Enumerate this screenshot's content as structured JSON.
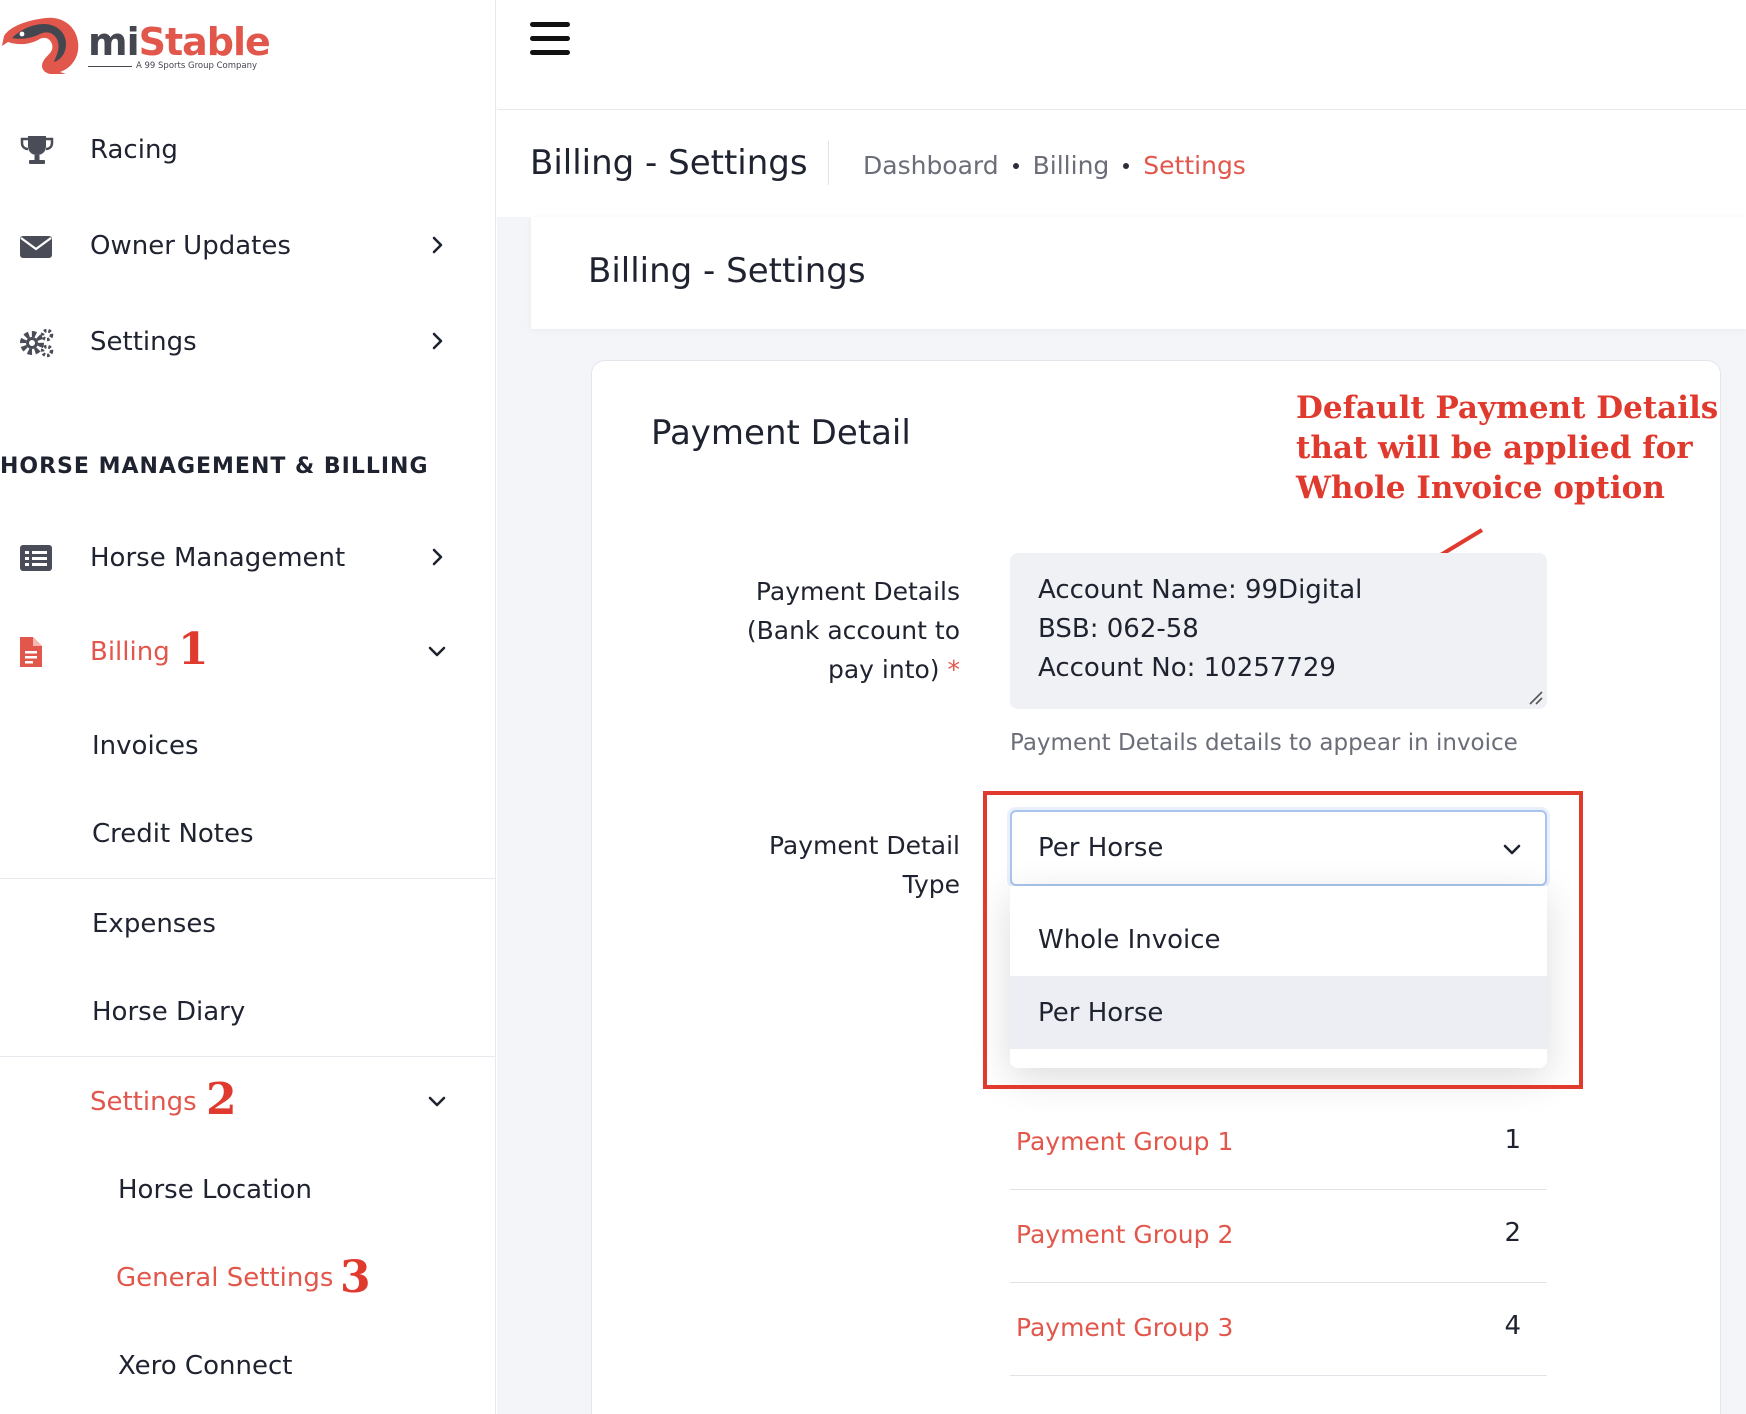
{
  "brand": {
    "name_part1": "mi",
    "name_part2": "Stable",
    "tagline": "A 99 Sports Group Company",
    "accent_color": "#e2574c"
  },
  "sidebar": {
    "top_items": [
      {
        "label": "Racing",
        "icon": "trophy-icon"
      },
      {
        "label": "Owner Updates",
        "icon": "envelope-icon"
      },
      {
        "label": "Settings",
        "icon": "gears-icon"
      }
    ],
    "section_label": "HORSE MANAGEMENT & BILLING",
    "horse_management": {
      "label": "Horse Management",
      "icon": "list-icon"
    },
    "billing": {
      "label": "Billing",
      "icon": "document-icon",
      "step": "1"
    },
    "billing_children": [
      "Invoices",
      "Credit Notes",
      "Expenses",
      "Horse Diary"
    ],
    "settings": {
      "label": "Settings",
      "step": "2"
    },
    "settings_children": [
      {
        "label": "Horse Location"
      },
      {
        "label": "General Settings",
        "step": "3"
      },
      {
        "label": "Xero Connect"
      }
    ]
  },
  "header": {
    "page_title": "Billing - Settings",
    "breadcrumbs": [
      "Dashboard",
      "Billing",
      "Settings"
    ]
  },
  "card": {
    "title": "Billing - Settings",
    "panel_title": "Payment Detail"
  },
  "annotation": {
    "lines": [
      "Default Payment Details",
      "that will be applied for",
      "Whole Invoice option"
    ]
  },
  "payment_details": {
    "label_lines": [
      "Payment Details",
      "(Bank account to",
      "pay into)"
    ],
    "required_mark": "*",
    "value_lines": [
      "Account Name: 99Digital",
      "BSB: 062-58",
      "Account No: 10257729"
    ],
    "help": "Payment Details details to appear in invoice"
  },
  "payment_detail_type": {
    "label_lines": [
      "Payment Detail",
      "Type"
    ],
    "selected": "Per Horse",
    "options": [
      "Whole Invoice",
      "Per Horse"
    ]
  },
  "payment_groups": [
    {
      "name": "Payment Group 1",
      "count": "1"
    },
    {
      "name": "Payment Group 2",
      "count": "2"
    },
    {
      "name": "Payment Group 3",
      "count": "4"
    }
  ]
}
